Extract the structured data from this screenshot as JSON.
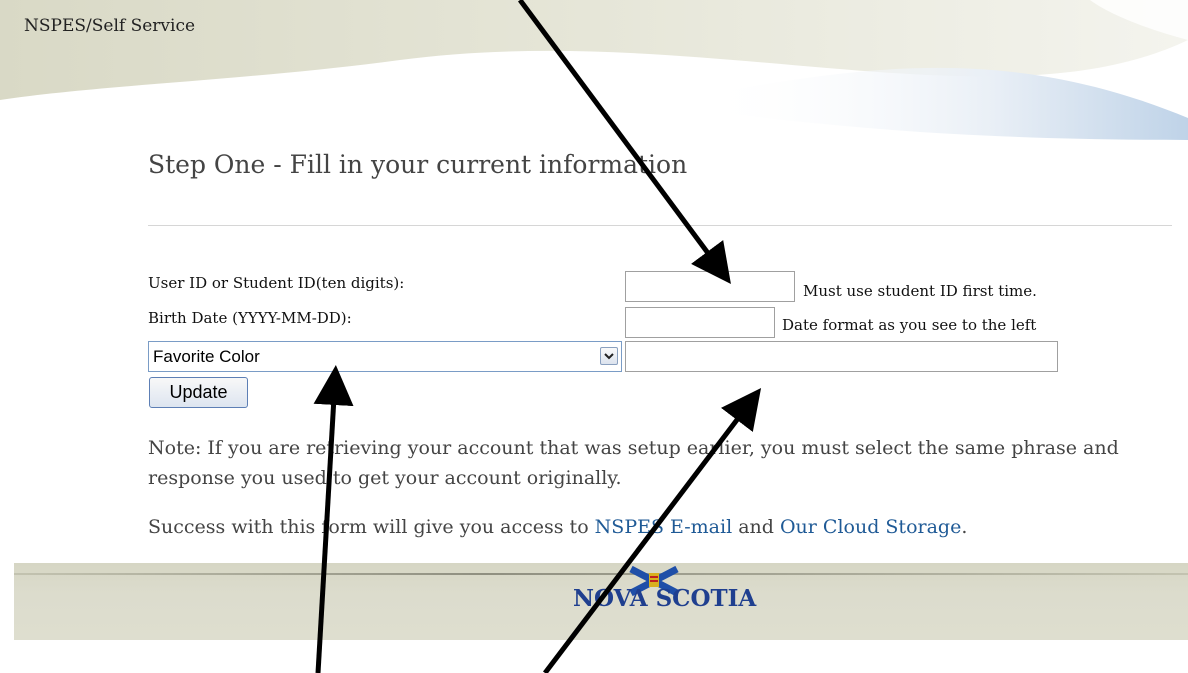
{
  "header": {
    "site_title": "NSPES/Self Service"
  },
  "form": {
    "step_title": "Step One - Fill in your current information",
    "user_id_label": "User ID or Student ID(ten digits):",
    "user_id_value": "",
    "user_id_hint": "Must use student ID first time.",
    "birth_date_label": "Birth Date (YYYY-MM-DD):",
    "birth_date_value": "",
    "birth_date_hint": "Date format as you see to the left",
    "phrase_select": {
      "selected": "Favorite Color"
    },
    "response_value": "",
    "update_label": "Update"
  },
  "notes": {
    "note_text": "Note: If you are retrieving your account that was setup earlier, you must select the same phrase and response you used to get your account originally.",
    "success_prefix": "Success with this form will give you access to ",
    "email_link": "NSPES E-mail",
    "conjunction": " and ",
    "cloud_link": "Our Cloud Storage",
    "success_suffix": "."
  },
  "footer": {
    "logo_text": "NOVA SCOTIA"
  },
  "colors": {
    "link": "#1f5a96",
    "logo": "#1f3f8f",
    "footer_bg": "#dcdccd",
    "arrow": "#000000"
  },
  "icons": {
    "select_arrow": "chevron-down-icon",
    "logo_mark": "nova-scotia-flag-icon"
  }
}
